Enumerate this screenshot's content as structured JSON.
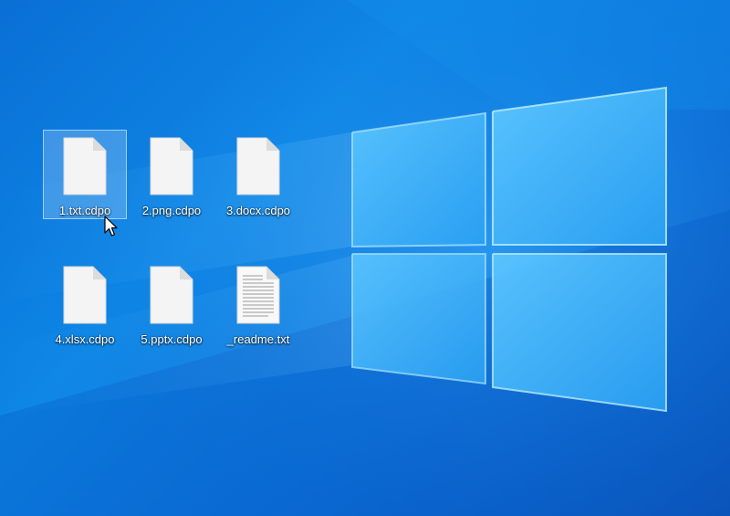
{
  "desktop": {
    "icons": [
      {
        "label": "1.txt.cdpo",
        "icon": "blank-file-icon",
        "selected": true
      },
      {
        "label": "2.png.cdpo",
        "icon": "blank-file-icon",
        "selected": false
      },
      {
        "label": "3.docx.cdpo",
        "icon": "blank-file-icon",
        "selected": false
      },
      {
        "label": "4.xlsx.cdpo",
        "icon": "blank-file-icon",
        "selected": false
      },
      {
        "label": "5.pptx.cdpo",
        "icon": "blank-file-icon",
        "selected": false
      },
      {
        "label": "_readme.txt",
        "icon": "text-document-icon",
        "selected": false
      }
    ]
  },
  "colors": {
    "wallpaper_blue": "#0b78dc",
    "selection_fill": "#a0cdf5",
    "label_text": "#ffffff"
  }
}
